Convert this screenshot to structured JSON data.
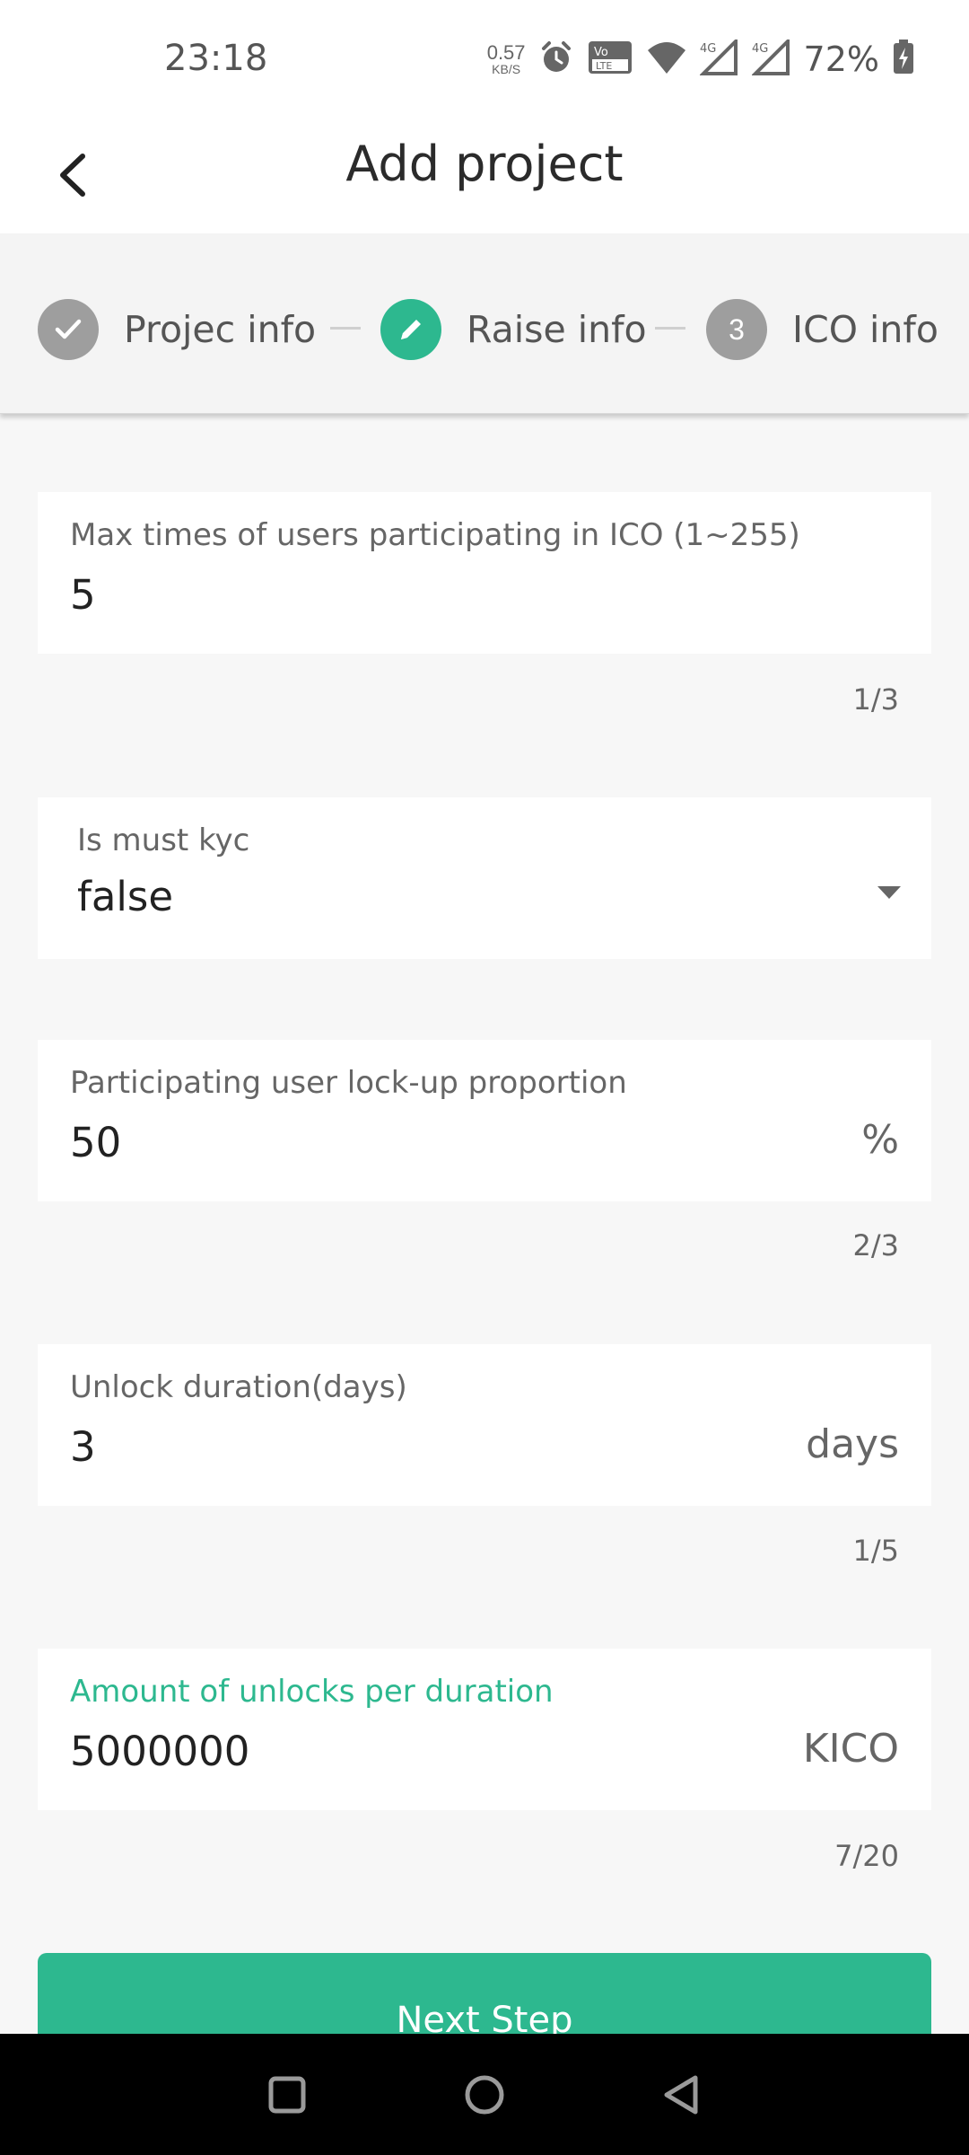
{
  "status_bar": {
    "time": "23:18",
    "net_speed_value": "0.57",
    "net_speed_unit": "KB/S",
    "battery_percent": "72%",
    "icons": [
      "alarm-icon",
      "volte-icon",
      "wifi-icon",
      "signal-4g-icon",
      "signal-4g-icon",
      "battery-charging-icon"
    ]
  },
  "header": {
    "title": "Add project",
    "back_icon": "back-arrow-icon"
  },
  "stepper": {
    "steps": [
      {
        "label": "Projec info",
        "state": "done",
        "icon": "check-icon",
        "color": "#9e9e9e"
      },
      {
        "label": "Raise info",
        "state": "current",
        "icon": "pencil-icon",
        "color": "#2db88f"
      },
      {
        "label": "ICO info",
        "state": "pending",
        "number": "3",
        "color": "#9e9e9e"
      }
    ]
  },
  "form": {
    "max_times": {
      "label": "Max times of users participating in ICO (1~255)",
      "value": "5",
      "counter": "1/3"
    },
    "must_kyc": {
      "label": "Is must kyc",
      "value": "false"
    },
    "lockup_proportion": {
      "label": "Participating user lock-up proportion",
      "value": "50",
      "suffix": "%",
      "counter": "2/3"
    },
    "unlock_duration": {
      "label": "Unlock duration(days)",
      "value": "3",
      "suffix": "days",
      "counter": "1/5"
    },
    "unlock_amount": {
      "label": "Amount of unlocks per duration",
      "value": "5000000",
      "suffix": "KICO",
      "counter": "7/20",
      "focused_color": "#2db88f"
    }
  },
  "next_button": {
    "label": "Next Step",
    "color": "#2db88f"
  },
  "nav_bar": {
    "icons": [
      "recent-apps-icon",
      "home-icon",
      "back-triangle-icon"
    ]
  }
}
